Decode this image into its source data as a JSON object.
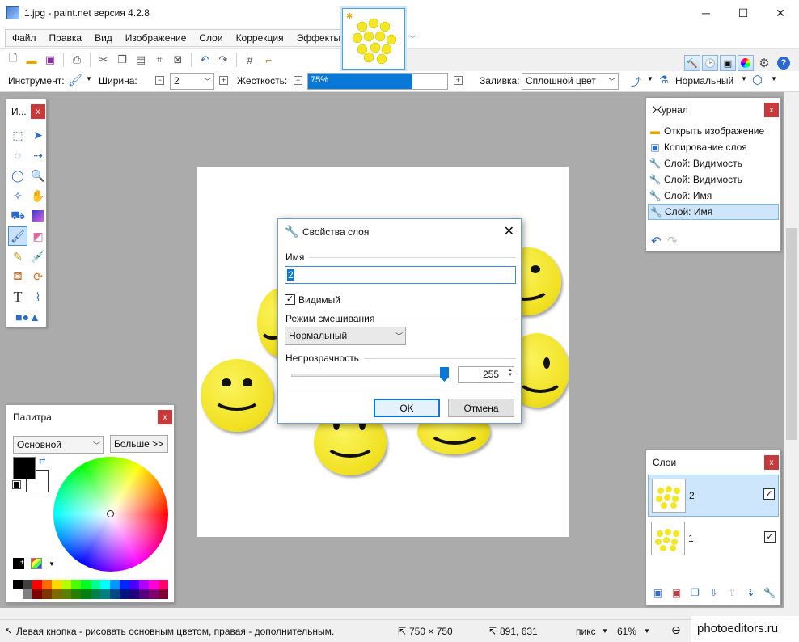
{
  "window": {
    "title": "1.jpg - paint.net версия 4.2.8",
    "minimize": "─",
    "maximize": "☐",
    "close": "✕"
  },
  "menu": [
    "Файл",
    "Правка",
    "Вид",
    "Изображение",
    "Слои",
    "Коррекция",
    "Эффекты"
  ],
  "options": {
    "tool_label": "Инструмент:",
    "width_label": "Ширина:",
    "width_value": "2",
    "hardness_label": "Жесткость:",
    "hardness_value": "75%",
    "hardness_percent": 75,
    "fill_label": "Заливка:",
    "fill_value": "Сплошной цвет",
    "blend_value": "Нормальный"
  },
  "tools_panel": {
    "title": "И...",
    "tools": [
      "rect-select",
      "move-selection",
      "lasso",
      "move-pixels",
      "ellipse",
      "zoom",
      "magic-wand",
      "pan",
      "paint-bucket",
      "gradient",
      "paintbrush",
      "eraser",
      "pencil",
      "color-picker",
      "clone-stamp",
      "recolor",
      "text",
      "line-curve",
      "shapes"
    ],
    "active": "paintbrush"
  },
  "history_panel": {
    "title": "Журнал",
    "items": [
      {
        "label": "Открыть изображение",
        "icon": "folder-icon"
      },
      {
        "label": "Копирование слоя",
        "icon": "layer-copy-icon"
      },
      {
        "label": "Слой: Видимость",
        "icon": "wrench-icon"
      },
      {
        "label": "Слой: Видимость",
        "icon": "wrench-icon"
      },
      {
        "label": "Слой: Имя",
        "icon": "wrench-icon"
      },
      {
        "label": "Слой: Имя",
        "icon": "wrench-icon",
        "selected": true
      }
    ]
  },
  "layers_panel": {
    "title": "Слои",
    "layers": [
      {
        "name": "2",
        "visible": true,
        "selected": true
      },
      {
        "name": "1",
        "visible": true,
        "selected": false
      }
    ]
  },
  "palette_panel": {
    "title": "Палитра",
    "mode": "Основной",
    "more_button": "Больше >>",
    "primary_color": "#000000",
    "secondary_color": "#ffffff",
    "swatches": [
      "#000000",
      "#404040",
      "#ff0000",
      "#ff6a00",
      "#ffd800",
      "#b6ff00",
      "#4cff00",
      "#00ff21",
      "#00ff90",
      "#00ffff",
      "#0094ff",
      "#0026ff",
      "#4800ff",
      "#b200ff",
      "#ff00dc",
      "#ff006e",
      "#ffffff",
      "#808080",
      "#7f0000",
      "#7f3300",
      "#7f6a00",
      "#5b7f00",
      "#267f00",
      "#007f0e",
      "#007f46",
      "#007f7f",
      "#004a7f",
      "#00137f",
      "#21007f",
      "#57007f",
      "#7f006e",
      "#7f0037"
    ]
  },
  "dialog": {
    "title": "Свойства слоя",
    "name_label": "Имя",
    "name_value": "2",
    "visible_label": "Видимый",
    "visible_checked": true,
    "blend_label": "Режим смешивания",
    "blend_value": "Нормальный",
    "opacity_label": "Непрозрачность",
    "opacity_value": "255",
    "ok": "OK",
    "cancel": "Отмена"
  },
  "status": {
    "hint": "Левая кнопка - рисовать основным цветом, правая - дополнительным.",
    "image_size": "750 × 750",
    "cursor_pos": "891, 631",
    "unit": "пикс",
    "zoom": "61%",
    "watermark": "photoeditors.ru"
  }
}
